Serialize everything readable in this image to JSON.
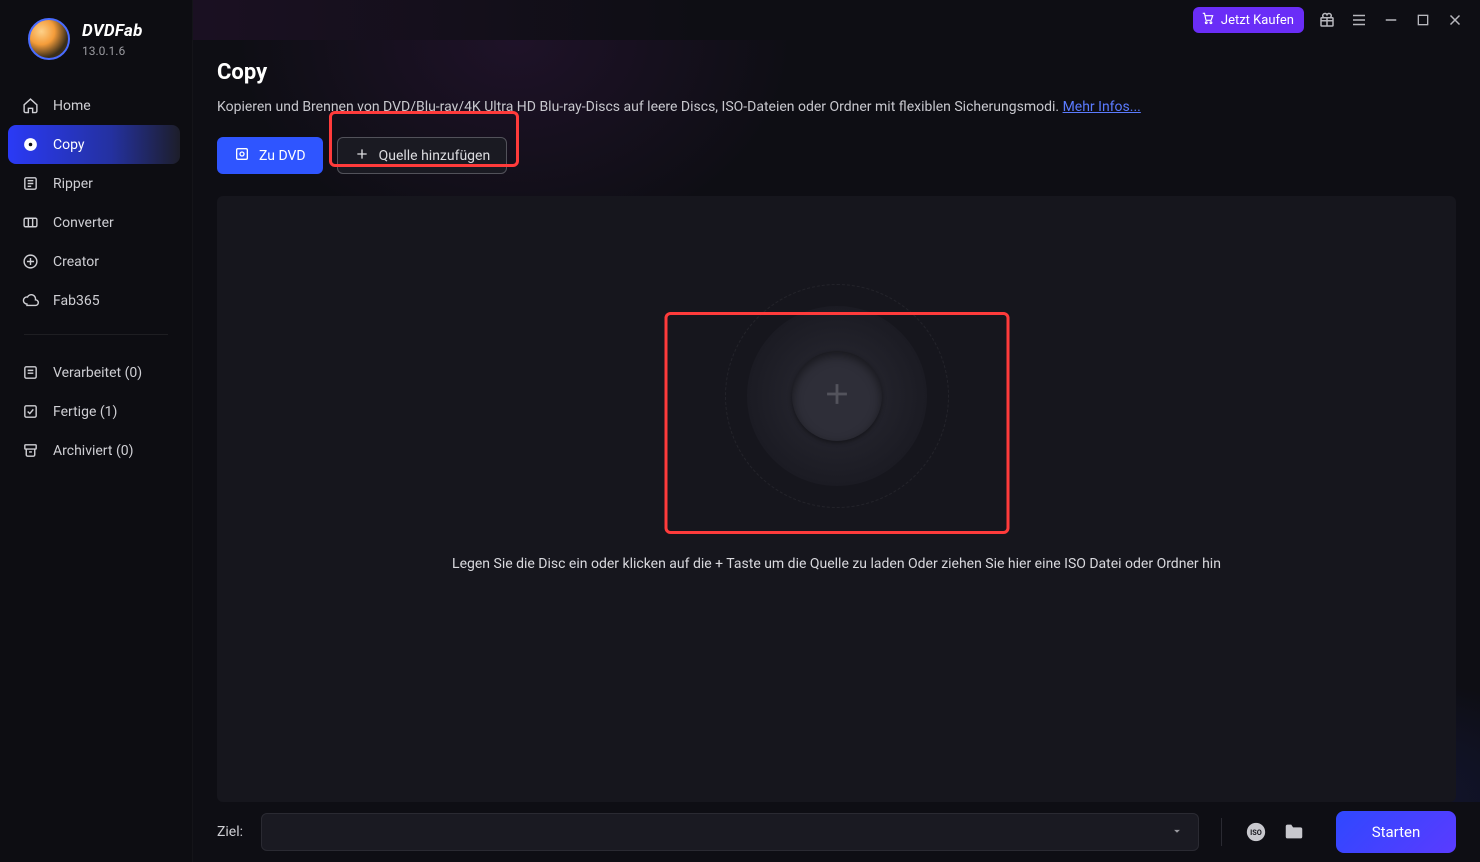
{
  "app": {
    "name": "DVDFab",
    "version": "13.0.1.6"
  },
  "topbar": {
    "buy_label": "Jetzt Kaufen"
  },
  "sidebar": {
    "items": [
      {
        "key": "home",
        "label": "Home"
      },
      {
        "key": "copy",
        "label": "Copy"
      },
      {
        "key": "ripper",
        "label": "Ripper"
      },
      {
        "key": "converter",
        "label": "Converter"
      },
      {
        "key": "creator",
        "label": "Creator"
      },
      {
        "key": "fab365",
        "label": "Fab365"
      }
    ],
    "status": [
      {
        "key": "processed",
        "label": "Verarbeitet (0)"
      },
      {
        "key": "finished",
        "label": "Fertige (1)"
      },
      {
        "key": "archived",
        "label": "Archiviert (0)"
      }
    ]
  },
  "page": {
    "title": "Copy",
    "description": "Kopieren und Brennen von DVD/Blu-ray/4K Ultra HD Blu-ray-Discs auf leere Discs, ISO-Dateien oder Ordner mit flexiblen Sicherungsmodi. ",
    "more_info": "Mehr Infos...",
    "to_dvd_label": "Zu DVD",
    "add_source_label": "Quelle hinzufügen",
    "drop_hint": "Legen Sie die Disc ein oder klicken auf die + Taste um die Quelle zu laden Oder ziehen Sie hier eine ISO Datei oder Ordner hin"
  },
  "bottom": {
    "target_label": "Ziel:",
    "start_label": "Starten"
  }
}
